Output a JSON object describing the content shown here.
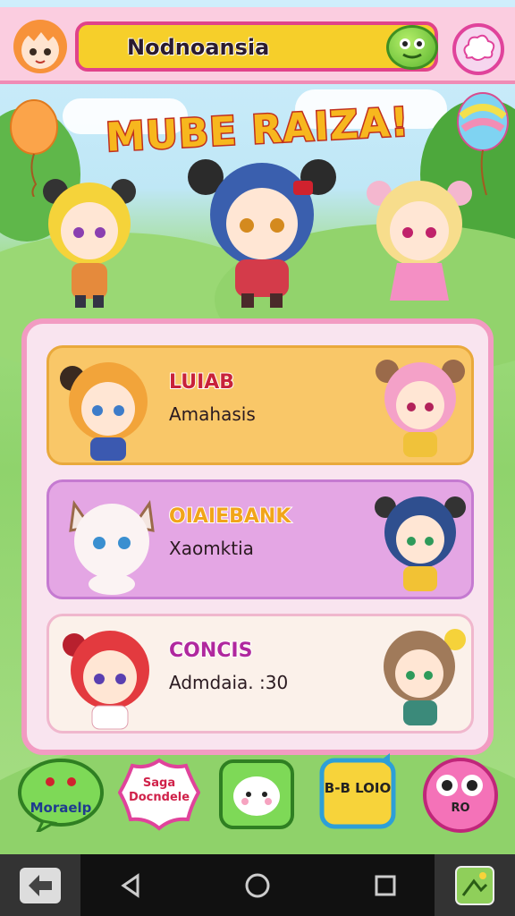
{
  "header": {
    "title": "Nodnoansia",
    "avatar_icon": "orange-haired-chibi-avatar",
    "action_icon": "green-frog-icon",
    "menu_icon": "pink-cloud-menu-icon"
  },
  "headline": "MUBE RAIZA!",
  "characters": [
    {
      "name": "LUIAB",
      "subtitle": "Amahasis",
      "bg": "#f9c768",
      "border": "#e9a93c",
      "name_color": "#c8223a"
    },
    {
      "name": "OIAIEBANK",
      "subtitle": "Xaomktia",
      "bg": "#e4a6e4",
      "border": "#c57ad1",
      "name_color": "#f1a51a"
    },
    {
      "name": "CONCIS",
      "subtitle": "Admdaia.  :30",
      "bg": "#fbf1ea",
      "border": "#f0b7cd",
      "name_color": "#b0289e"
    }
  ],
  "bottom_buttons": [
    {
      "label": "Moraelp",
      "icon": "green-speech-bubble-icon"
    },
    {
      "label": "Saga Docndele",
      "icon": "pink-badge-icon"
    },
    {
      "label": "",
      "icon": "cute-animal-chat-icon"
    },
    {
      "label": "B-B LOIO",
      "icon": "yellow-notice-icon"
    },
    {
      "label": "RO",
      "icon": "pink-eyeball-icon"
    }
  ],
  "navbar": {
    "back_icon": "back-arrow-icon",
    "triangle_icon": "nav-back-triangle-icon",
    "home_icon": "nav-home-circle-icon",
    "recents_icon": "nav-recents-square-icon",
    "app_icon": "app-shortcut-icon"
  }
}
